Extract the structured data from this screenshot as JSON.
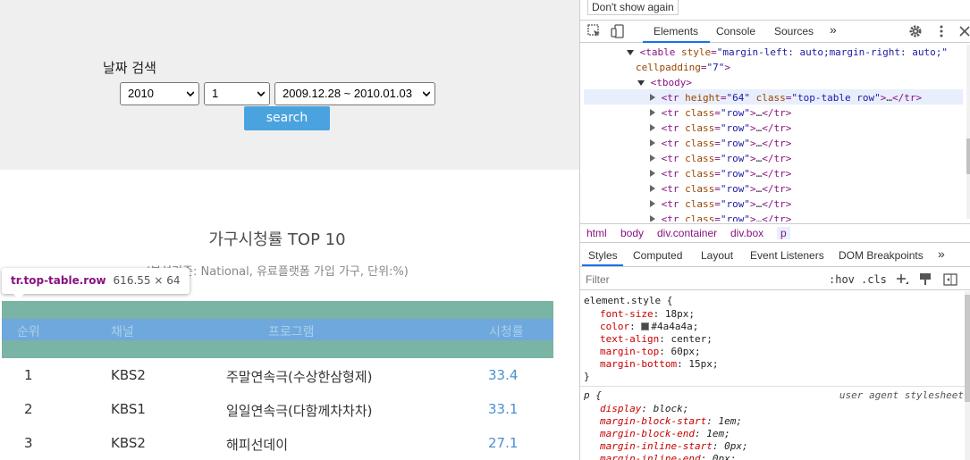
{
  "search": {
    "label": "날짜 검색",
    "year": "2010",
    "week": "1",
    "range": "2009.12.28 ~ 2010.01.03",
    "button": "search"
  },
  "ranking": {
    "title": "가구시청률 TOP 10",
    "subtitle": "(분석기준: National, 유료플랫폼 가입 가구, 단위:%)",
    "headers": [
      "순위",
      "채널",
      "프로그램",
      "시청률"
    ],
    "rows": [
      {
        "rank": "1",
        "channel": "KBS2",
        "program": "주말연속극(수상한삼형제)",
        "rating": "33.4"
      },
      {
        "rank": "2",
        "channel": "KBS1",
        "program": "일일연속극(다함께차차차)",
        "rating": "33.1"
      },
      {
        "rank": "3",
        "channel": "KBS2",
        "program": "해피선데이",
        "rating": "27.1"
      }
    ]
  },
  "tooltip": {
    "name": "tr.top-table.row",
    "size": "616.55 × 64"
  },
  "devtools": {
    "dont_show": "Don't show again",
    "tabs": [
      "Elements",
      "Console",
      "Sources"
    ],
    "more": "»",
    "dom": {
      "table_tag": "<table ",
      "table_attr": "style",
      "table_val": "\"margin-left: auto;margin-right: auto;\"",
      "table_attr2": "cellpadding",
      "table_val2": "\"7\"",
      "tbody": "<tbody>",
      "selected_tr": "<tr ",
      "selected_attr1": "height",
      "selected_val1": "\"64\"",
      "selected_attr2": "class",
      "selected_val2": "\"top-table row\"",
      "row_attr": "class",
      "row_val": "\"row\"",
      "ellipsis": "…",
      "close_tr": "</tr>",
      "open_tr": "<tr ",
      "gt": ">"
    },
    "breadcrumb": [
      "html",
      "body",
      "div.container",
      "div.box",
      "p"
    ],
    "style_tabs": [
      "Styles",
      "Computed",
      "Layout",
      "Event Listeners",
      "DOM Breakpoints"
    ],
    "filter_placeholder": "Filter",
    "hov": ":hov",
    "cls": ".cls",
    "element_style_selector": "element.style {",
    "element_style": [
      {
        "prop": "font-size",
        "value": "18px;"
      },
      {
        "prop": "color",
        "value": "#4a4a4a;"
      },
      {
        "prop": "text-align",
        "value": "center;"
      },
      {
        "prop": "margin-top",
        "value": "60px;"
      },
      {
        "prop": "margin-bottom",
        "value": "15px;"
      }
    ],
    "close_brace": "}",
    "p_selector": "p {",
    "ua_label": "user agent stylesheet",
    "p_style": [
      {
        "prop": "display",
        "value": "block;"
      },
      {
        "prop": "margin-block-start",
        "value": "1em;"
      },
      {
        "prop": "margin-block-end",
        "value": "1em;"
      },
      {
        "prop": "margin-inline-start",
        "value": "0px;"
      },
      {
        "prop": "margin-inline-end",
        "value": "0px;"
      }
    ]
  },
  "colors": {
    "accent_blue": "#4aa3df",
    "header_green": "#79b4a5",
    "header_blue": "#6fa8dc",
    "devtools_active": "#1a73e8"
  }
}
